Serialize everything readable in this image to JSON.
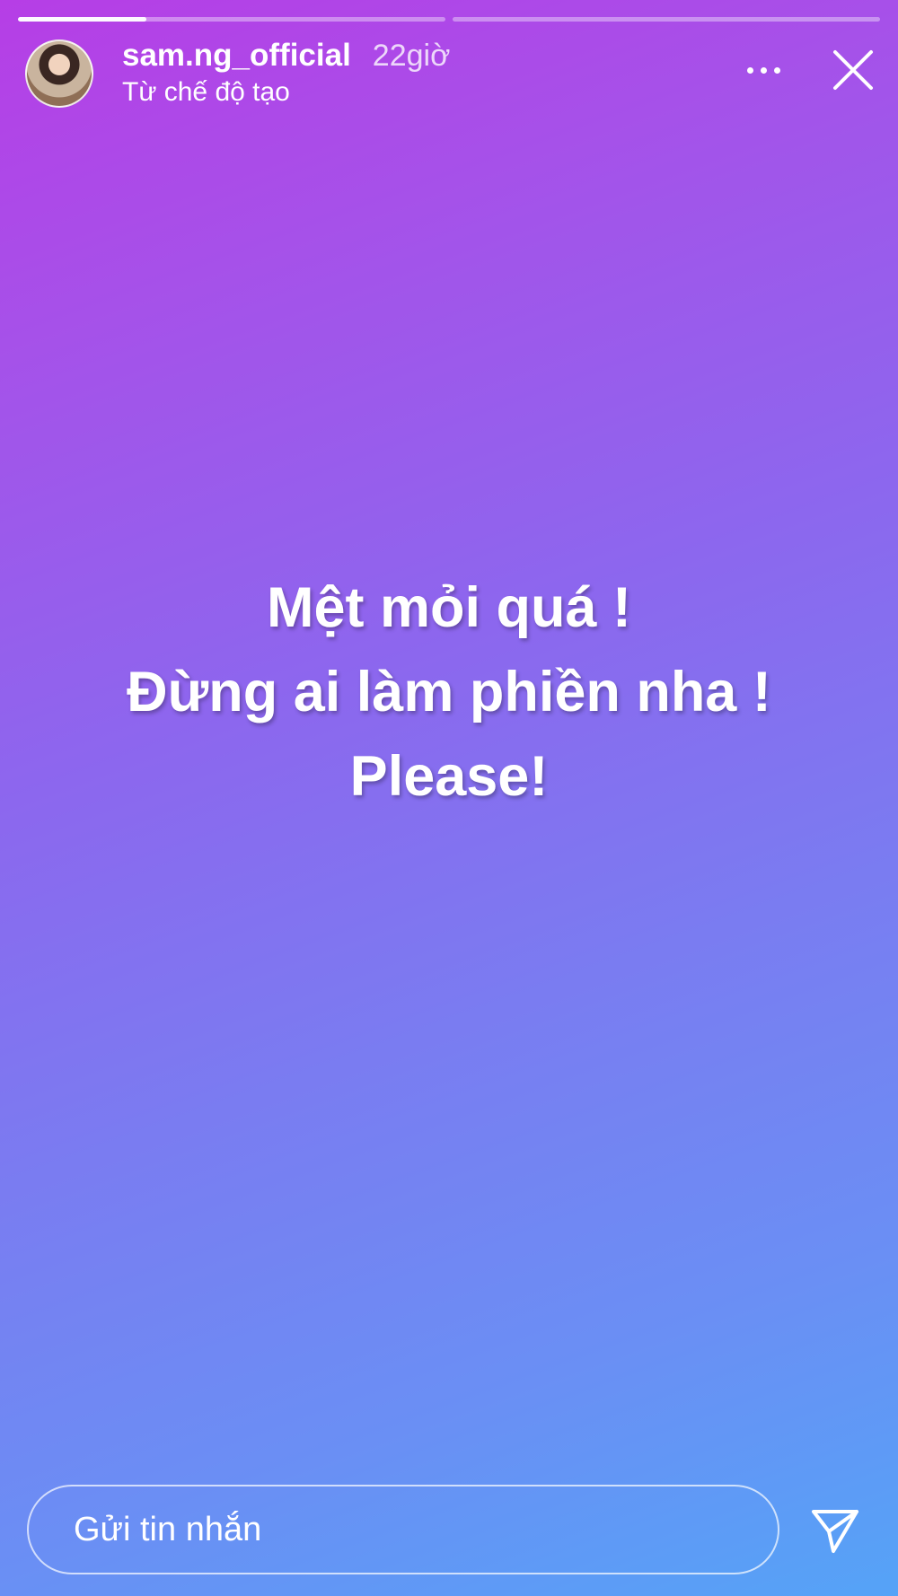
{
  "story": {
    "progress": [
      0.3,
      0.0
    ],
    "username": "sam.ng_official",
    "timestamp": "22giờ",
    "mode_label": "Từ chế độ tạo",
    "lines": [
      "Mệt mỏi quá !",
      "Đừng ai làm phiền nha !",
      "Please!"
    ]
  },
  "reply": {
    "placeholder": "Gửi tin nhắn"
  },
  "icons": {
    "more": "more-icon",
    "close": "close-icon",
    "send": "send-icon"
  },
  "colors": {
    "gradient_start": "#b63ee6",
    "gradient_end": "#55a3f7"
  }
}
